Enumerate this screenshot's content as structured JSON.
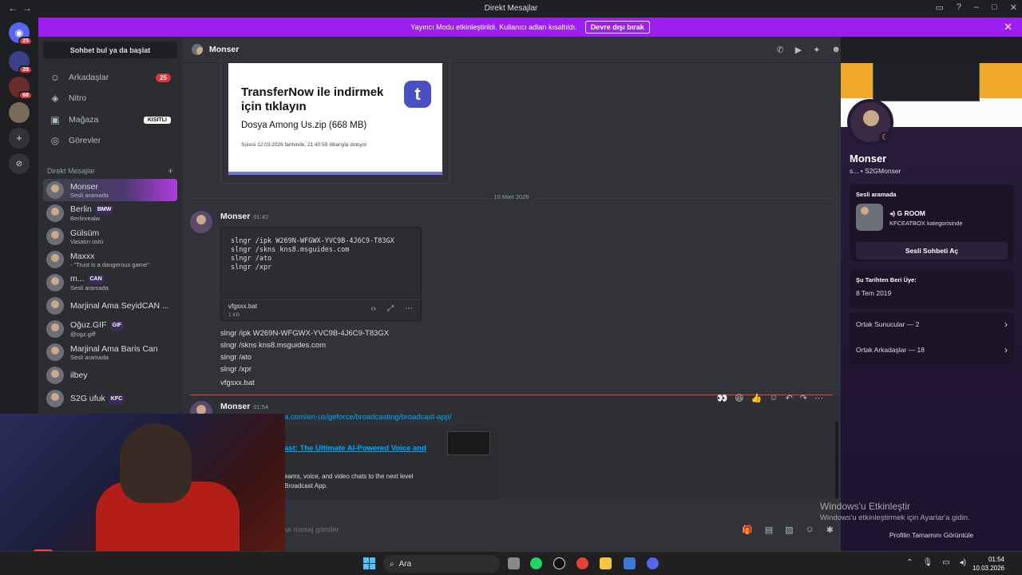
{
  "window": {
    "title": "Direkt Mesajlar"
  },
  "banner": {
    "text": "Yayıncı Modu etkinleştirildi. Kullanıcı adları kısaltıldı.",
    "button": "Devre dışı bırak"
  },
  "guilds": {
    "home_badge": "25",
    "items": [
      {
        "badge": "28"
      },
      {
        "badge": "68"
      }
    ]
  },
  "sidebar": {
    "search": "Sohbet bul ya da başlat",
    "nav": [
      {
        "label": "Arkadaşlar",
        "badge": "25"
      },
      {
        "label": "Nitro"
      },
      {
        "label": "Mağaza",
        "badge": "KISITLI"
      },
      {
        "label": "Görevler"
      }
    ],
    "dm_header": "Direkt Mesajlar",
    "dms": [
      {
        "name": "Monser",
        "status": "Sesli aramada"
      },
      {
        "name": "Berlin",
        "tag": "BMW",
        "status": "Berlinrealw"
      },
      {
        "name": "Gülsüm",
        "status": "Vasatın üstü"
      },
      {
        "name": "Maxxx",
        "status": "- \"Trust is a dangerous game\""
      },
      {
        "name": "m...",
        "tag": "CAN",
        "status": "Sesli aramada"
      },
      {
        "name": "Marjinal Ama SeyidCAN ...",
        "status": ""
      },
      {
        "name": "Oğuz.GIF",
        "tag": "GIF",
        "status": "@ogz.giff"
      },
      {
        "name": "Marjinal Ama Baris Can",
        "status": "Sesli aramada"
      },
      {
        "name": "ilbey",
        "status": ""
      },
      {
        "name": "S2G ufuk",
        "tag": "KFC",
        "status": ""
      }
    ]
  },
  "channel": {
    "name": "Monser"
  },
  "embed": {
    "title": "TransferNow ile indirmek için tıklayın",
    "file": "Dosya Among Us.zip (668 MB)",
    "expiry": "Süresi 12.03.2026 tarihinde, 21:40:59 itibarıyla doluyor",
    "logo": "t"
  },
  "date_divider": "10 Mart 2026",
  "message1": {
    "author": "Monser",
    "time": "01:42",
    "code": "slngr /ipk W269N-WFGWX-YVC9B-4J6C9-T83GX\nslngr /skns kns8.msguides.com\nslngr /ato\nslngr /xpr",
    "file_name": "vfgsxx.bat",
    "file_size": "1 KB",
    "lines": [
      "slngr /ipk W269N-WFGWX-YVC9B-4J6C9-T83GX",
      "slngr /skns kns8.msguides.com",
      "slngr /ato",
      "slngr /xpr",
      "vfgsxx.bat"
    ]
  },
  "message2": {
    "author": "Monser",
    "time": "01:54",
    "link": "a.com/en-us/geforce/broadcasting/broadcast-app/",
    "embed_title": "ast: The Ultimate AI-Powered Voice and",
    "embed_desc_1": "eams, voice, and video chats to the next level",
    "embed_desc_2": "Broadcast App."
  },
  "composer": {
    "placeholder": "ısına mesaj gönder"
  },
  "profile": {
    "name": "Monser",
    "username": "s... • S2GMonser",
    "voice_header": "Sesli aramada",
    "voice_room": "G ROOM",
    "voice_category": "KFCEATBOX kategorisinde",
    "voice_button": "Sesli Sohbeti Aç",
    "member_header": "Şu Tarihten Beri Üye:",
    "member_since": "8 Tem 2019",
    "mutual_servers": "Ortak Sunucular — 2",
    "mutual_friends": "Ortak Arkadaşlar — 18",
    "full_profile": "Profilin Tamamını Görüntüle"
  },
  "watermark": {
    "line1": "Windows'u Etkinleştir",
    "line2": "Windows'u etkinleştirmek için Ayarlar'a gidin."
  },
  "taskbar": {
    "search": "Ara",
    "time": "01:54",
    "date": "10.03.2026"
  },
  "colors": {
    "brand": "#5865f2",
    "banner": "#9b1ff0",
    "danger": "#da373c",
    "link": "#00a8fc"
  }
}
